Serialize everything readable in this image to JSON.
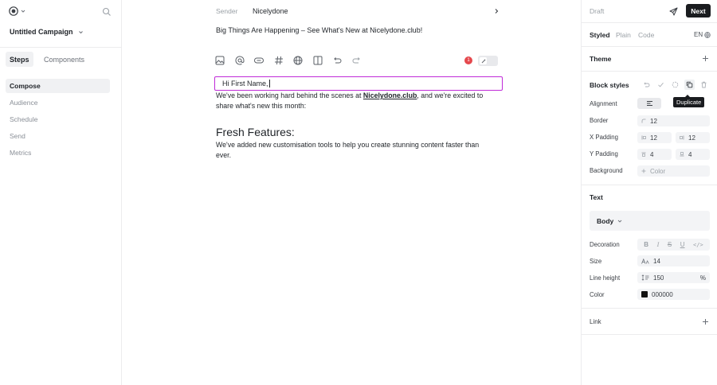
{
  "left": {
    "campaign_name": "Untitled Campaign",
    "tabs": [
      {
        "label": "Steps",
        "active": true
      },
      {
        "label": "Components",
        "active": false
      }
    ],
    "nav": [
      {
        "label": "Compose",
        "active": true
      },
      {
        "label": "Audience",
        "active": false
      },
      {
        "label": "Schedule",
        "active": false
      },
      {
        "label": "Send",
        "active": false
      },
      {
        "label": "Metrics",
        "active": false
      }
    ]
  },
  "center": {
    "sender_label": "Sender",
    "sender_value": "Nicelydone",
    "subject": "Big Things Are Happening – See What's New at Nicelydone.club!",
    "error_count": "1",
    "toolbar_icons": [
      "image-icon",
      "mention-icon",
      "button-icon",
      "hashtag-icon",
      "globe-icon",
      "columns-icon",
      "undo-icon",
      "redo-icon"
    ],
    "greeting": "Hi First Name,",
    "para1_before": "We've been working hard behind the scenes at ",
    "para1_link": "Nicelydone.club",
    "para1_after": ", and we're excited to share what's new this month:",
    "features_heading": "Fresh Features:",
    "para2": "We've added new customisation tools to help you create stunning content faster than ever."
  },
  "right": {
    "status": "Draft",
    "next_label": "Next",
    "modes": [
      {
        "label": "Styled",
        "active": true
      },
      {
        "label": "Plain",
        "active": false
      },
      {
        "label": "Code",
        "active": false
      }
    ],
    "language": "EN",
    "theme_title": "Theme",
    "block_styles_title": "Block styles",
    "tooltip": "Duplicate",
    "alignment_label": "Alignment",
    "border_label": "Border",
    "border_value": "12",
    "x_padding_label": "X Padding",
    "x_padding_left": "12",
    "x_padding_right": "12",
    "y_padding_label": "Y Padding",
    "y_padding_top": "4",
    "y_padding_bottom": "4",
    "background_label": "Background",
    "background_placeholder": "Color",
    "text_title": "Text",
    "text_style": "Body",
    "decoration_label": "Decoration",
    "size_label": "Size",
    "size_value": "14",
    "line_height_label": "Line height",
    "line_height_value": "150",
    "line_height_unit": "%",
    "color_label": "Color",
    "color_value": "000000",
    "link_title": "Link"
  },
  "colors": {
    "accent_outline": "#c02ad8",
    "error": "#e5484d",
    "next_button": "#1a1c1f"
  }
}
